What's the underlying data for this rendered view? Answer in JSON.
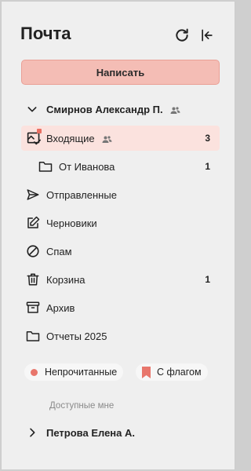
{
  "header": {
    "title": "Почта",
    "refresh_icon": "refresh-icon",
    "collapse_icon": "collapse-sidebar-icon"
  },
  "compose": {
    "label": "Написать"
  },
  "account": {
    "name": "Смирнов Александр П.",
    "shared_icon": "shared-users-icon"
  },
  "folders": [
    {
      "label": "Входящие",
      "icon": "inbox-icon",
      "count": "3",
      "active": true,
      "shared": true
    },
    {
      "label": "От Иванова",
      "icon": "folder-icon",
      "count": "1",
      "sub": true
    },
    {
      "label": "Отправленные",
      "icon": "send-icon",
      "count": ""
    },
    {
      "label": "Черновики",
      "icon": "draft-icon",
      "count": ""
    },
    {
      "label": "Спам",
      "icon": "spam-icon",
      "count": ""
    },
    {
      "label": "Корзина",
      "icon": "trash-icon",
      "count": "1"
    },
    {
      "label": "Архив",
      "icon": "archive-icon",
      "count": ""
    },
    {
      "label": "Отчеты 2025",
      "icon": "folder-icon",
      "count": ""
    }
  ],
  "filters": {
    "unread": "Непрочитанные",
    "flagged": "С флагом"
  },
  "shared_section": {
    "label": "Доступные мне",
    "account": "Петрова Елена А."
  },
  "colors": {
    "accent": "#f4bdb5",
    "active_row": "#fbe2de",
    "badge": "#ea6f63"
  }
}
